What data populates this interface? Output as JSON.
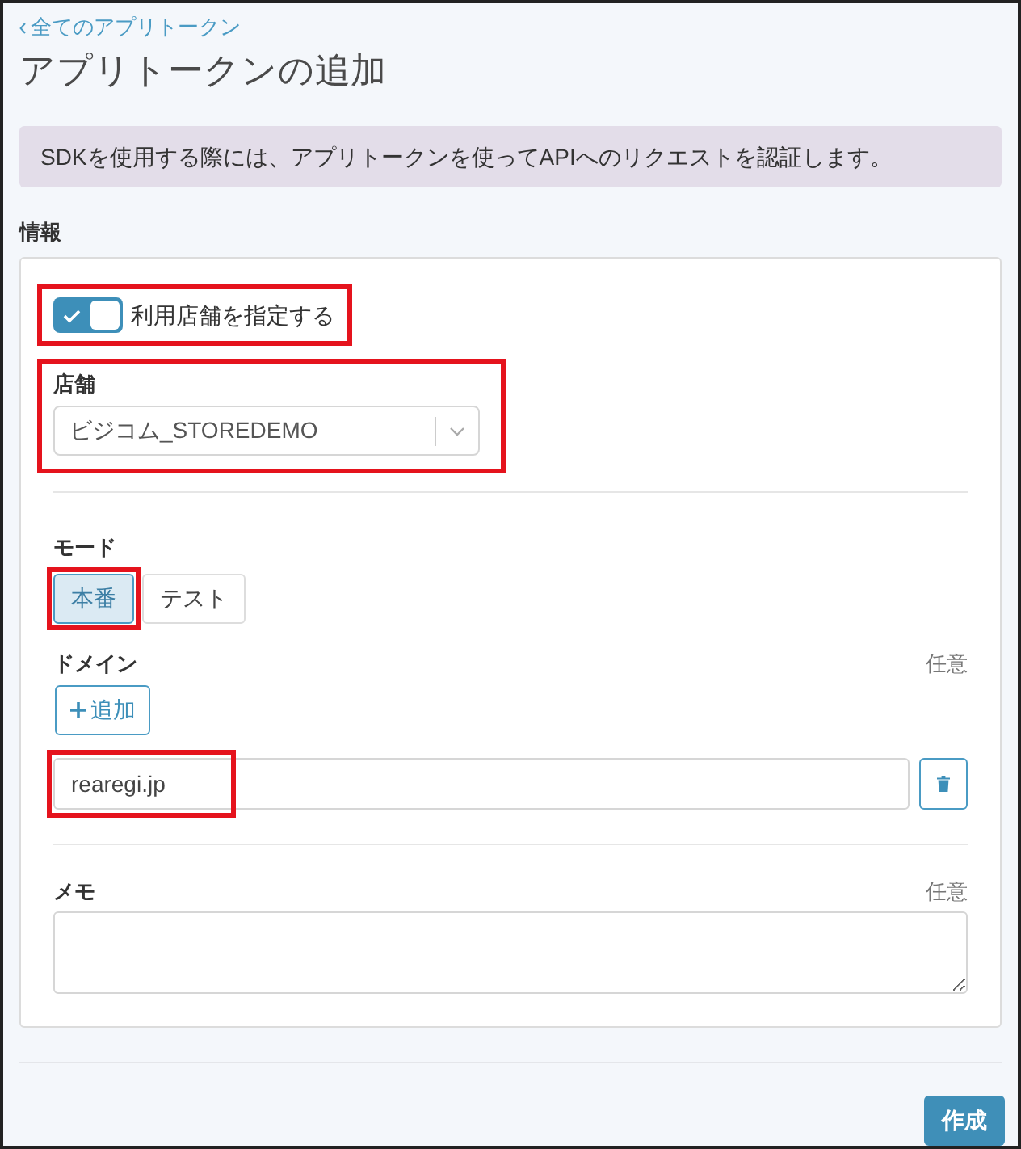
{
  "breadcrumb": {
    "label": "全てのアプリトークン"
  },
  "title": "アプリトークンの追加",
  "notice": "SDKを使用する際には、アプリトークンを使ってAPIへのリクエストを認証します。",
  "section": {
    "label": "情報"
  },
  "store_toggle": {
    "label": "利用店舗を指定する",
    "on": true,
    "highlighted": true
  },
  "store_field": {
    "label": "店舗",
    "value": "ビジコム_STOREDEMO",
    "highlighted": true
  },
  "mode": {
    "label": "モード",
    "options": [
      {
        "label": "本番",
        "selected": true,
        "highlighted": true
      },
      {
        "label": "テスト",
        "selected": false,
        "highlighted": false
      }
    ]
  },
  "domain": {
    "label": "ドメイン",
    "optional_note": "任意",
    "add_button": "追加",
    "entries": [
      {
        "value": "rearegi.jp",
        "highlighted": true
      }
    ]
  },
  "memo": {
    "label": "メモ",
    "optional_note": "任意"
  },
  "create_button": "作成"
}
